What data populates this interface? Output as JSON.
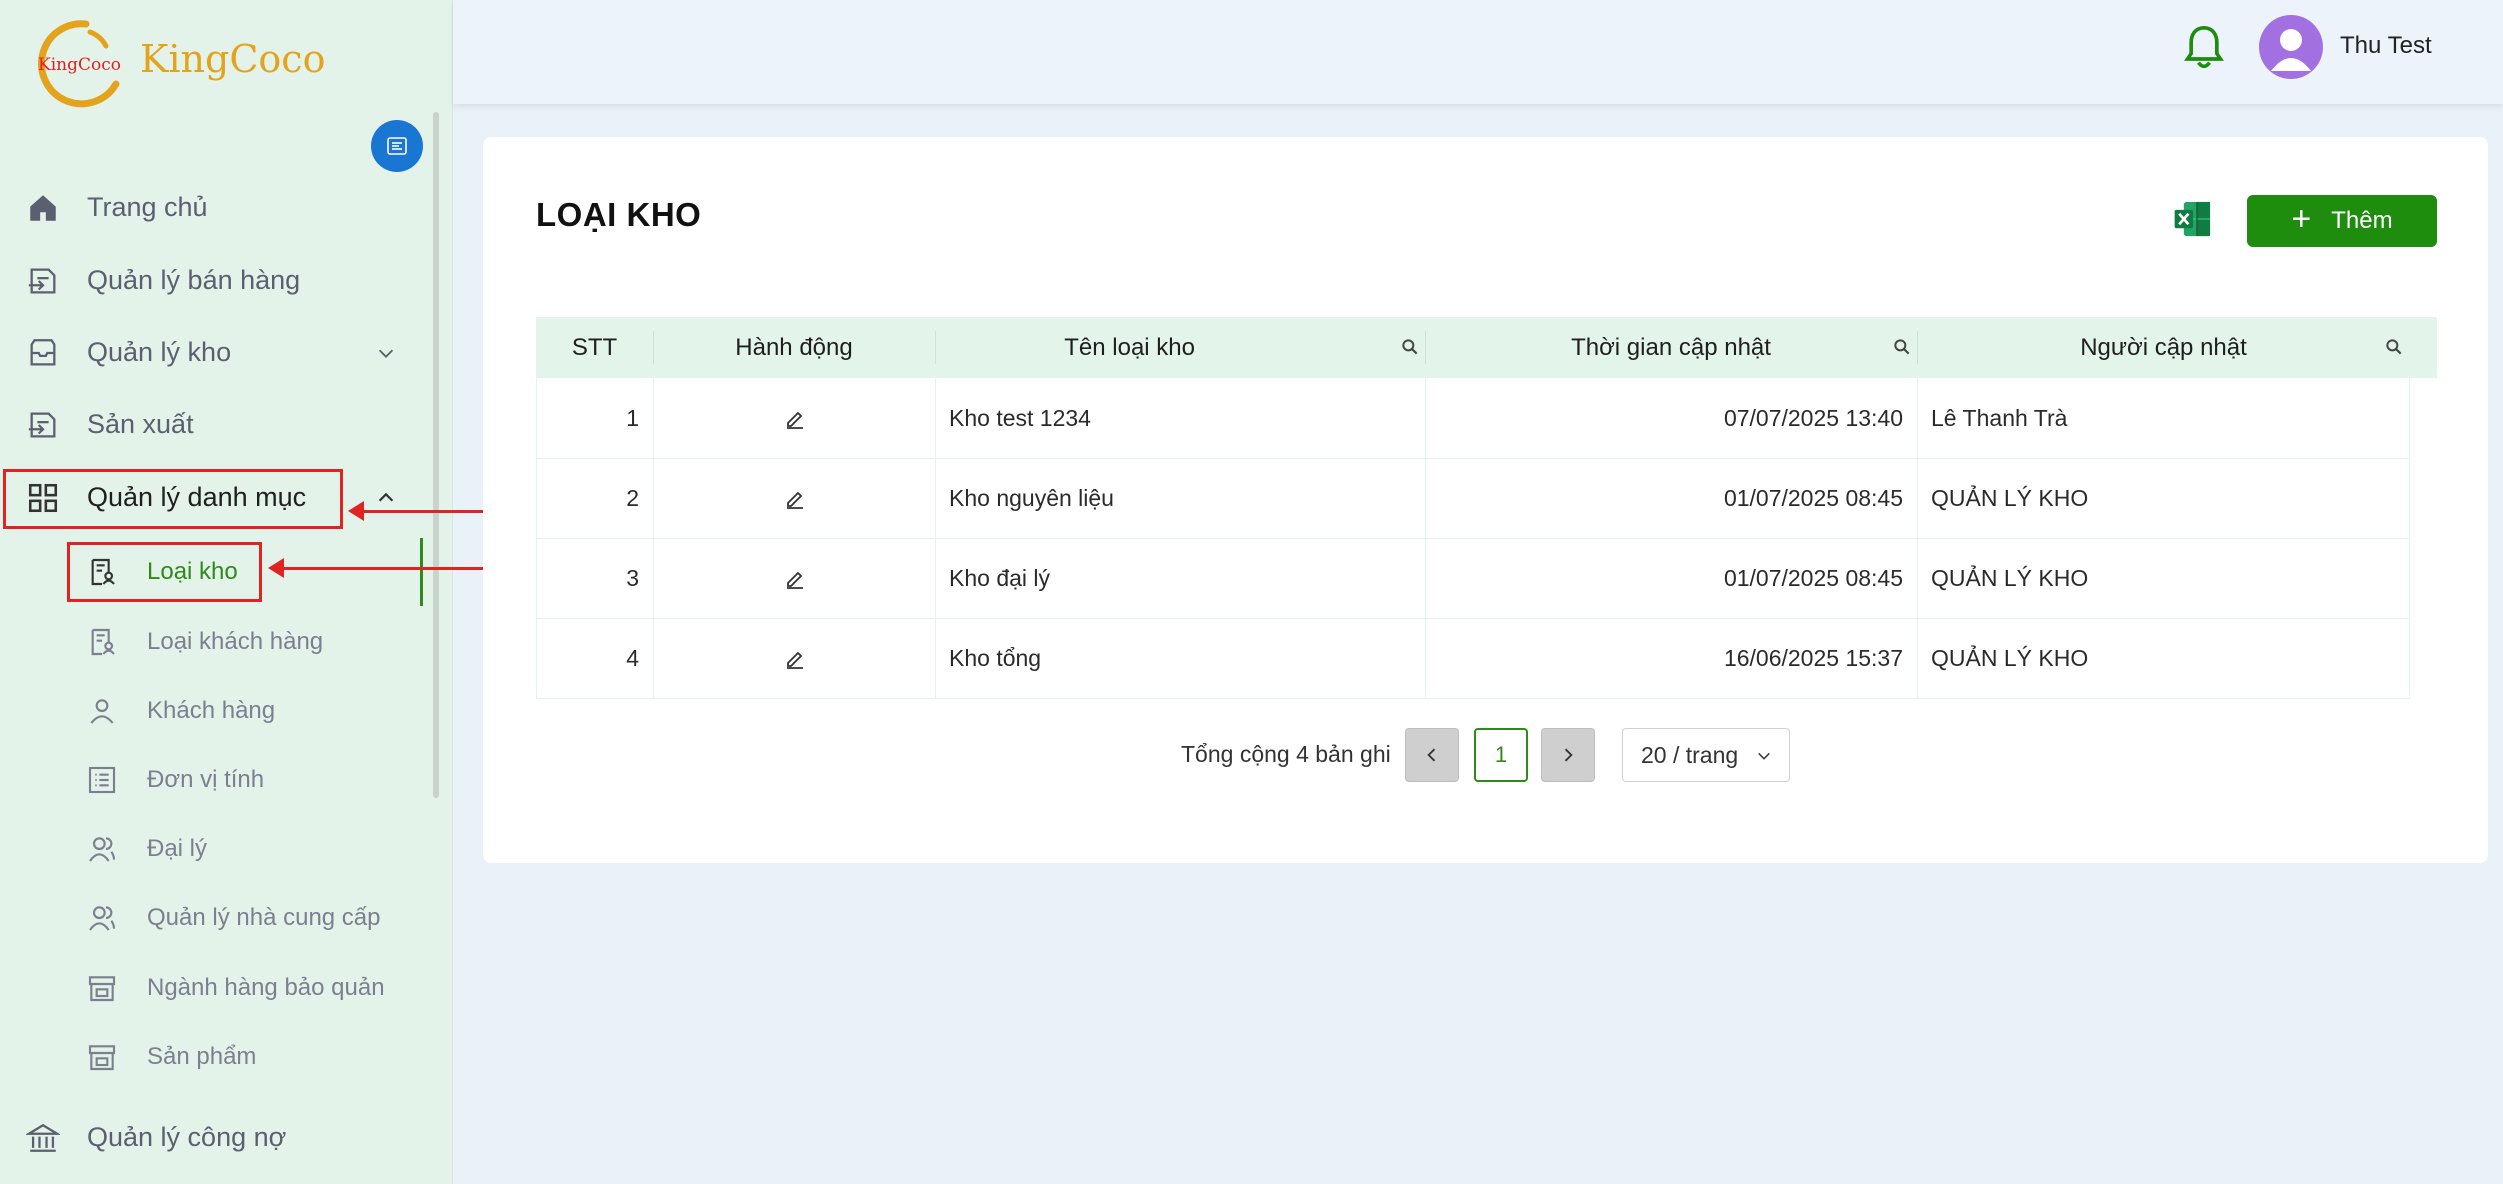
{
  "app": {
    "logo_text": "KingCoco",
    "logo_mark_text": "KingCoco"
  },
  "header": {
    "user_name": "Thu Test"
  },
  "sidebar": {
    "items": [
      {
        "label": "Trang chủ",
        "icon": "home-icon"
      },
      {
        "label": "Quản lý bán hàng",
        "icon": "sales-icon"
      },
      {
        "label": "Quản lý kho",
        "icon": "warehouse-icon"
      },
      {
        "label": "Sản xuất",
        "icon": "production-icon"
      },
      {
        "label": "Quản lý danh mục",
        "icon": "grid-icon"
      },
      {
        "label": "Quản lý công nợ",
        "icon": "bank-icon"
      }
    ],
    "sub_items": [
      {
        "label": "Loại kho",
        "icon": "document-user-icon",
        "selected": true
      },
      {
        "label": "Loại khách hàng",
        "icon": "document-user-icon"
      },
      {
        "label": "Khách hàng",
        "icon": "user-icon"
      },
      {
        "label": "Đơn vị tính",
        "icon": "list-icon"
      },
      {
        "label": "Đại lý",
        "icon": "users-icon"
      },
      {
        "label": "Quản lý nhà cung cấp",
        "icon": "users-icon"
      },
      {
        "label": "Ngành hàng bảo quản",
        "icon": "store-icon"
      },
      {
        "label": "Sản phẩm",
        "icon": "store-icon"
      }
    ]
  },
  "page": {
    "title": "LOẠI KHO",
    "add_label": "Thêm"
  },
  "table": {
    "columns": [
      "STT",
      "Hành động",
      "Tên loại kho",
      "Thời gian cập nhật",
      "Người cập nhật"
    ],
    "rows": [
      {
        "stt": "1",
        "name": "Kho test 1234",
        "updated": "07/07/2025 13:40",
        "by": "Lê Thanh Trà"
      },
      {
        "stt": "2",
        "name": "Kho nguyên liệu",
        "updated": "01/07/2025 08:45",
        "by": "QUẢN LÝ KHO"
      },
      {
        "stt": "3",
        "name": "Kho đại lý",
        "updated": "01/07/2025 08:45",
        "by": "QUẢN LÝ KHO"
      },
      {
        "stt": "4",
        "name": "Kho tổng",
        "updated": "16/06/2025 15:37",
        "by": "QUẢN LÝ KHO"
      }
    ]
  },
  "pagination": {
    "total_text": "Tổng cộng 4 bản ghi",
    "current_page": "1",
    "page_size": "20 / trang"
  },
  "colors": {
    "primary": "#1e8c0c",
    "sidebar_bg": "#e4f3ea",
    "table_header_bg": "#e3f4ea",
    "annotation": "#e02424"
  }
}
